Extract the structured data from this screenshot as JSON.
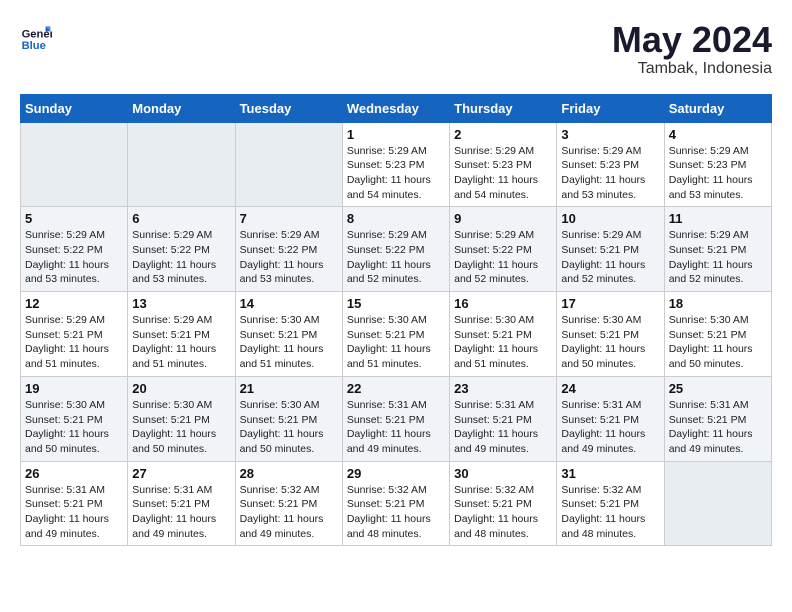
{
  "header": {
    "logo_line1": "General",
    "logo_line2": "Blue",
    "month_year": "May 2024",
    "location": "Tambak, Indonesia"
  },
  "days_of_week": [
    "Sunday",
    "Monday",
    "Tuesday",
    "Wednesday",
    "Thursday",
    "Friday",
    "Saturday"
  ],
  "weeks": [
    [
      {
        "day": "",
        "info": ""
      },
      {
        "day": "",
        "info": ""
      },
      {
        "day": "",
        "info": ""
      },
      {
        "day": "1",
        "info": "Sunrise: 5:29 AM\nSunset: 5:23 PM\nDaylight: 11 hours\nand 54 minutes."
      },
      {
        "day": "2",
        "info": "Sunrise: 5:29 AM\nSunset: 5:23 PM\nDaylight: 11 hours\nand 54 minutes."
      },
      {
        "day": "3",
        "info": "Sunrise: 5:29 AM\nSunset: 5:23 PM\nDaylight: 11 hours\nand 53 minutes."
      },
      {
        "day": "4",
        "info": "Sunrise: 5:29 AM\nSunset: 5:23 PM\nDaylight: 11 hours\nand 53 minutes."
      }
    ],
    [
      {
        "day": "5",
        "info": "Sunrise: 5:29 AM\nSunset: 5:22 PM\nDaylight: 11 hours\nand 53 minutes."
      },
      {
        "day": "6",
        "info": "Sunrise: 5:29 AM\nSunset: 5:22 PM\nDaylight: 11 hours\nand 53 minutes."
      },
      {
        "day": "7",
        "info": "Sunrise: 5:29 AM\nSunset: 5:22 PM\nDaylight: 11 hours\nand 53 minutes."
      },
      {
        "day": "8",
        "info": "Sunrise: 5:29 AM\nSunset: 5:22 PM\nDaylight: 11 hours\nand 52 minutes."
      },
      {
        "day": "9",
        "info": "Sunrise: 5:29 AM\nSunset: 5:22 PM\nDaylight: 11 hours\nand 52 minutes."
      },
      {
        "day": "10",
        "info": "Sunrise: 5:29 AM\nSunset: 5:21 PM\nDaylight: 11 hours\nand 52 minutes."
      },
      {
        "day": "11",
        "info": "Sunrise: 5:29 AM\nSunset: 5:21 PM\nDaylight: 11 hours\nand 52 minutes."
      }
    ],
    [
      {
        "day": "12",
        "info": "Sunrise: 5:29 AM\nSunset: 5:21 PM\nDaylight: 11 hours\nand 51 minutes."
      },
      {
        "day": "13",
        "info": "Sunrise: 5:29 AM\nSunset: 5:21 PM\nDaylight: 11 hours\nand 51 minutes."
      },
      {
        "day": "14",
        "info": "Sunrise: 5:30 AM\nSunset: 5:21 PM\nDaylight: 11 hours\nand 51 minutes."
      },
      {
        "day": "15",
        "info": "Sunrise: 5:30 AM\nSunset: 5:21 PM\nDaylight: 11 hours\nand 51 minutes."
      },
      {
        "day": "16",
        "info": "Sunrise: 5:30 AM\nSunset: 5:21 PM\nDaylight: 11 hours\nand 51 minutes."
      },
      {
        "day": "17",
        "info": "Sunrise: 5:30 AM\nSunset: 5:21 PM\nDaylight: 11 hours\nand 50 minutes."
      },
      {
        "day": "18",
        "info": "Sunrise: 5:30 AM\nSunset: 5:21 PM\nDaylight: 11 hours\nand 50 minutes."
      }
    ],
    [
      {
        "day": "19",
        "info": "Sunrise: 5:30 AM\nSunset: 5:21 PM\nDaylight: 11 hours\nand 50 minutes."
      },
      {
        "day": "20",
        "info": "Sunrise: 5:30 AM\nSunset: 5:21 PM\nDaylight: 11 hours\nand 50 minutes."
      },
      {
        "day": "21",
        "info": "Sunrise: 5:30 AM\nSunset: 5:21 PM\nDaylight: 11 hours\nand 50 minutes."
      },
      {
        "day": "22",
        "info": "Sunrise: 5:31 AM\nSunset: 5:21 PM\nDaylight: 11 hours\nand 49 minutes."
      },
      {
        "day": "23",
        "info": "Sunrise: 5:31 AM\nSunset: 5:21 PM\nDaylight: 11 hours\nand 49 minutes."
      },
      {
        "day": "24",
        "info": "Sunrise: 5:31 AM\nSunset: 5:21 PM\nDaylight: 11 hours\nand 49 minutes."
      },
      {
        "day": "25",
        "info": "Sunrise: 5:31 AM\nSunset: 5:21 PM\nDaylight: 11 hours\nand 49 minutes."
      }
    ],
    [
      {
        "day": "26",
        "info": "Sunrise: 5:31 AM\nSunset: 5:21 PM\nDaylight: 11 hours\nand 49 minutes."
      },
      {
        "day": "27",
        "info": "Sunrise: 5:31 AM\nSunset: 5:21 PM\nDaylight: 11 hours\nand 49 minutes."
      },
      {
        "day": "28",
        "info": "Sunrise: 5:32 AM\nSunset: 5:21 PM\nDaylight: 11 hours\nand 49 minutes."
      },
      {
        "day": "29",
        "info": "Sunrise: 5:32 AM\nSunset: 5:21 PM\nDaylight: 11 hours\nand 48 minutes."
      },
      {
        "day": "30",
        "info": "Sunrise: 5:32 AM\nSunset: 5:21 PM\nDaylight: 11 hours\nand 48 minutes."
      },
      {
        "day": "31",
        "info": "Sunrise: 5:32 AM\nSunset: 5:21 PM\nDaylight: 11 hours\nand 48 minutes."
      },
      {
        "day": "",
        "info": ""
      }
    ]
  ]
}
